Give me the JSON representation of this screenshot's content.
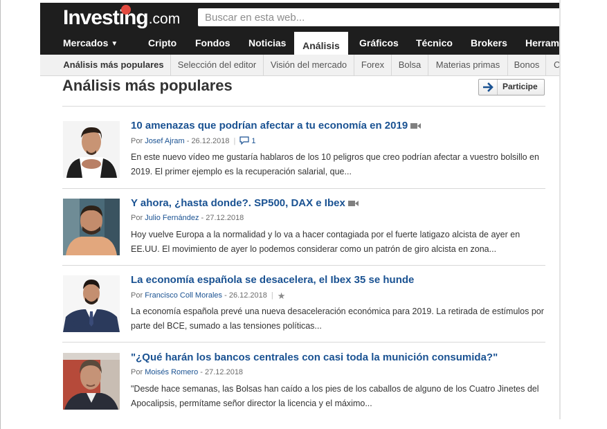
{
  "brand": {
    "name": "Investing",
    "tld": ".com",
    "dot_color": "#e34b40"
  },
  "search": {
    "placeholder": "Buscar en esta web..."
  },
  "nav": {
    "items": [
      {
        "label": "Mercados",
        "has_chevron": true
      },
      {
        "label": "Cripto"
      },
      {
        "label": "Fondos"
      },
      {
        "label": "Noticias"
      },
      {
        "label": "Análisis",
        "active": true
      },
      {
        "label": "Gráficos"
      },
      {
        "label": "Técnico"
      },
      {
        "label": "Brokers"
      },
      {
        "label": "Herramie"
      }
    ]
  },
  "subnav": {
    "items": [
      {
        "label": "Análisis más populares",
        "active": true
      },
      {
        "label": "Selección del editor"
      },
      {
        "label": "Visión del mercado"
      },
      {
        "label": "Forex"
      },
      {
        "label": "Bolsa"
      },
      {
        "label": "Materias primas"
      },
      {
        "label": "Bonos"
      },
      {
        "label": "C"
      }
    ]
  },
  "section": {
    "title": "Análisis más populares",
    "participe_label": "Participe"
  },
  "colors": {
    "link": "#1a5292",
    "header_bg": "#1e1e1e"
  },
  "articles": [
    {
      "title": "10 amenazas que podrían afectar a tu economía en 2019",
      "has_video": true,
      "by": "Por",
      "author": "Josef Ajram",
      "date": "- 26.12.2018",
      "comments": "1",
      "excerpt": "En este nuevo vídeo me gustaría hablaros de los 10 peligros que creo podrían afectar a vuestro bolsillo en 2019. El primer ejemplo es la recuperación salarial, que..."
    },
    {
      "title": "Y ahora, ¿hasta donde?. SP500, DAX e Ibex",
      "has_video": true,
      "by": "Por",
      "author": "Julio Fernández",
      "date": "- 27.12.2018",
      "excerpt": "Hoy vuelve Europa a la normalidad y lo va a hacer contagiada por el fuerte latigazo alcista de ayer en EE.UU. El movimiento de ayer lo podemos considerar como un patrón de giro alcista en zona..."
    },
    {
      "title": "La economía española se desacelera, el Ibex 35 se hunde",
      "has_video": false,
      "by": "Por",
      "author": "Francisco Coll Morales",
      "date": "- 26.12.2018",
      "has_star": true,
      "excerpt": "La economía española prevé una nueva desaceleración económica para 2019. La retirada de estímulos por parte del BCE, sumado a las tensiones políticas..."
    },
    {
      "title": "\"¿Qué harán los bancos centrales con casi toda la munición consumida?\"",
      "has_video": false,
      "by": "Por",
      "author": "Moisés Romero",
      "date": "- 27.12.2018",
      "excerpt": "\"Desde hace semanas, las Bolsas han caído a los pies de los caballos de alguno de los Cuatro Jinetes del Apocalipsis, permítame señor director la licencia y el máximo..."
    }
  ]
}
